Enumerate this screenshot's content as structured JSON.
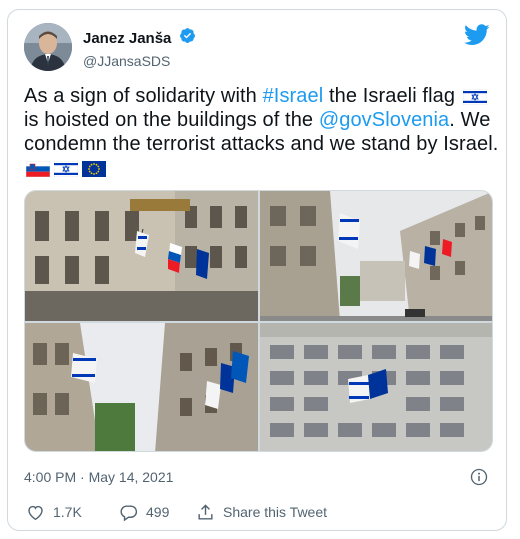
{
  "user": {
    "display_name": "Janez Janša",
    "handle": "@JJansaSDS",
    "verified": true,
    "avatar": "profile-photo"
  },
  "platform_icon": "twitter-bird-icon",
  "tweet": {
    "text_parts": {
      "p1": "As a sign of solidarity with ",
      "hashtag": "#Israel",
      "p2": " the Israeli flag ",
      "flag1": "🇮🇱",
      "p3": " is hoisted on the buildings of the ",
      "mention": "@govSlovenia",
      "p4": ". We condemn the terrorist attacks and we stand by Israel.",
      "emoji_flags": [
        "🇸🇮",
        "🇮🇱",
        "🇪🇺"
      ]
    },
    "timestamp": "4:00 PM · May 14, 2021"
  },
  "media": {
    "photos": [
      "building-with-flags-1",
      "street-view-with-flags",
      "flags-on-facade-low-angle",
      "office-building-with-flags"
    ]
  },
  "actions": {
    "likes": "1.7K",
    "replies": "499",
    "share_label": "Share this Tweet"
  },
  "colors": {
    "link": "#1d9bf0",
    "muted": "#536471",
    "border": "#cfd9de",
    "verified": "#1d9bf0",
    "like": "#536471"
  }
}
